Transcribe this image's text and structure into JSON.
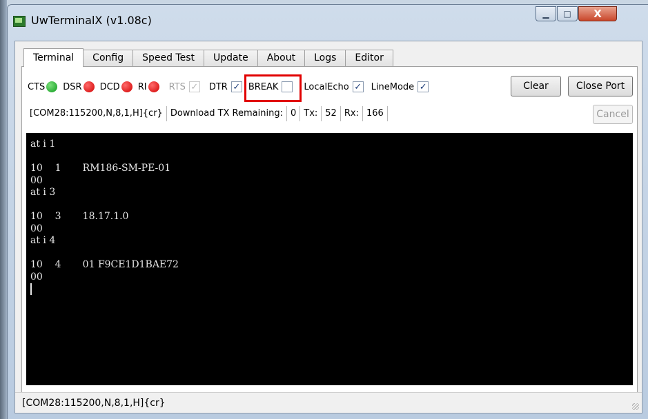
{
  "window": {
    "title": "UwTerminalX (v1.08c)",
    "minimize_symbol": "▁",
    "maximize_symbol": "□",
    "close_symbol": "X"
  },
  "tabs": [
    "Terminal",
    "Config",
    "Speed Test",
    "Update",
    "About",
    "Logs",
    "Editor"
  ],
  "signals": [
    {
      "label": "CTS",
      "state": "green"
    },
    {
      "label": "DSR",
      "state": "red"
    },
    {
      "label": "DCD",
      "state": "red"
    },
    {
      "label": "RI",
      "state": "red"
    }
  ],
  "checkboxes": [
    {
      "label": "RTS",
      "checked": true,
      "disabled": true
    },
    {
      "label": "DTR",
      "checked": true,
      "disabled": false
    },
    {
      "label": "BREAK",
      "checked": false,
      "disabled": false
    },
    {
      "label": "LocalEcho",
      "checked": true,
      "disabled": false
    },
    {
      "label": "LineMode",
      "checked": true,
      "disabled": false
    }
  ],
  "buttons": {
    "clear": "Clear",
    "close_port": "Close Port",
    "cancel": "Cancel"
  },
  "status_row": {
    "port": "[COM28:115200,N,8,1,H]{cr}",
    "download_label": "Download TX Remaining:",
    "download_value": "0",
    "tx_label": "Tx:",
    "tx_value": "52",
    "rx_label": "Rx:",
    "rx_value": "166"
  },
  "terminal_lines": [
    "at i 1",
    "",
    "10    1       RM186-SM-PE-01",
    "00",
    "at i 3",
    "",
    "10    3       18.17.1.0",
    "00",
    "at i 4",
    "",
    "10    4       01 F9CE1D1BAE72",
    "00"
  ],
  "statusbar": "[COM28:115200,N,8,1,H]{cr}",
  "colors": {
    "signal_green": "#0f9a1e",
    "signal_red": "#d10000",
    "highlight": "#e10000"
  }
}
